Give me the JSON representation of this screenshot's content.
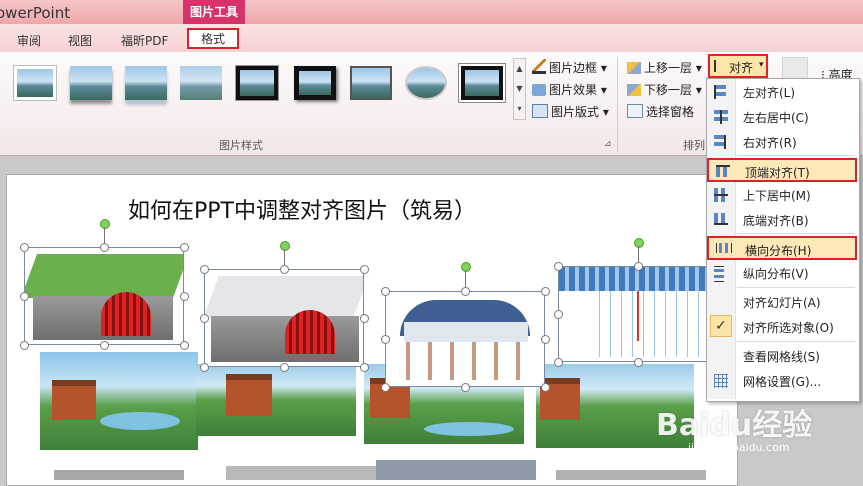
{
  "app": {
    "title": "owerPoint"
  },
  "context_tab": {
    "label": "图片工具"
  },
  "tabs": [
    {
      "label": "审阅"
    },
    {
      "label": "视图"
    },
    {
      "label": "福昕PDF"
    },
    {
      "label": "格式"
    }
  ],
  "ribbon": {
    "picture_border": "图片边框",
    "picture_effects": "图片效果",
    "picture_layout": "图片版式",
    "bring_forward": "上移一层",
    "send_backward": "下移一层",
    "selection_pane": "选择窗格",
    "align": "对齐",
    "picture_styles_group": "图片样式",
    "arrange_group": "排列"
  },
  "slide": {
    "title": "如何在PPT中调整对齐图片（筑易）"
  },
  "align_menu": {
    "items": [
      {
        "label": "左对齐(L)",
        "icon": "align-left-icon"
      },
      {
        "label": "左右居中(C)",
        "icon": "align-center-icon"
      },
      {
        "label": "右对齐(R)",
        "icon": "align-right-icon"
      },
      {
        "label": "顶端对齐(T)",
        "icon": "align-top-icon",
        "highlighted": true
      },
      {
        "label": "上下居中(M)",
        "icon": "align-middle-icon"
      },
      {
        "label": "底端对齐(B)",
        "icon": "align-bottom-icon"
      },
      {
        "label": "横向分布(H)",
        "icon": "distribute-horizontal-icon",
        "highlighted": true
      },
      {
        "label": "纵向分布(V)",
        "icon": "distribute-vertical-icon"
      },
      {
        "label": "对齐幻灯片(A)",
        "icon": ""
      },
      {
        "label": "对齐所选对象(O)",
        "icon": "check-icon",
        "checked": true
      },
      {
        "label": "查看网格线(S)",
        "icon": ""
      },
      {
        "label": "网格设置(G)...",
        "icon": "grid-icon"
      }
    ]
  },
  "watermark": {
    "brand": "Baidu经验",
    "url": "jingyan.baidu.com"
  },
  "colors": {
    "highlight_border": "#e0202a",
    "context_tab": "#d7336b"
  }
}
